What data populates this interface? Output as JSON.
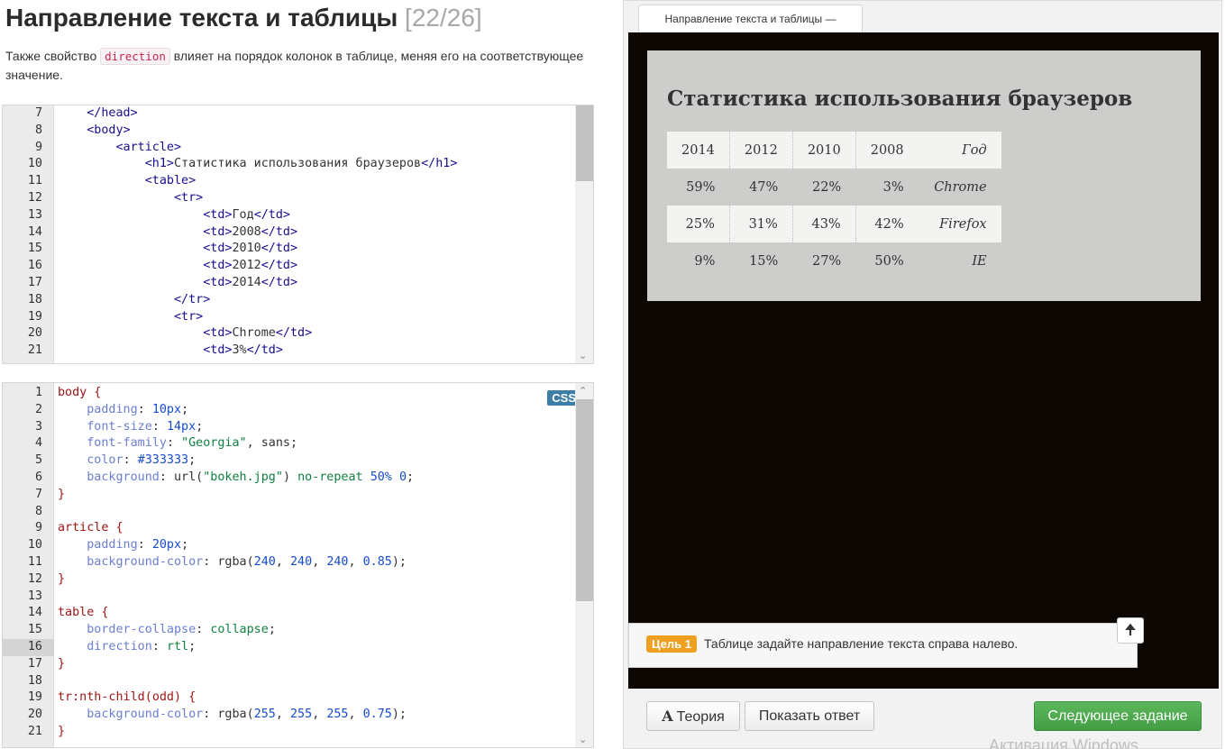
{
  "header": {
    "title": "Направление текста и таблицы",
    "progress": "[22/26]",
    "intro_before": "Также свойство ",
    "intro_code": "direction",
    "intro_after": " влияет на порядок колонок в таблице, меняя его на соответствующее значение."
  },
  "html_editor": {
    "lines": [
      {
        "n": "7"
      },
      {
        "n": "8"
      },
      {
        "n": "9"
      },
      {
        "n": "10"
      },
      {
        "n": "11"
      },
      {
        "n": "12"
      },
      {
        "n": "13"
      },
      {
        "n": "14"
      },
      {
        "n": "15"
      },
      {
        "n": "16"
      },
      {
        "n": "17"
      },
      {
        "n": "18"
      },
      {
        "n": "19"
      },
      {
        "n": "20"
      },
      {
        "n": "21"
      }
    ],
    "code": {
      "l7": "</head>",
      "l8": "<body>",
      "l9": "<article>",
      "l10a": "<h1>",
      "l10b": "Статистика использования браузеров",
      "l10c": "</h1>",
      "l11": "<table>",
      "l12": "<tr>",
      "l13a": "<td>",
      "l13b": "Год",
      "l13c": "</td>",
      "l14a": "<td>",
      "l14b": "2008",
      "l14c": "</td>",
      "l15a": "<td>",
      "l15b": "2010",
      "l15c": "</td>",
      "l16a": "<td>",
      "l16b": "2012",
      "l16c": "</td>",
      "l17a": "<td>",
      "l17b": "2014",
      "l17c": "</td>",
      "l18": "</tr>",
      "l19": "<tr>",
      "l20a": "<td>",
      "l20b": "Chrome",
      "l20c": "</td>",
      "l21a": "<td>",
      "l21b": "3%",
      "l21c": "</td>"
    }
  },
  "css_editor": {
    "badge": "CSS",
    "lines": [
      {
        "n": "1"
      },
      {
        "n": "2"
      },
      {
        "n": "3"
      },
      {
        "n": "4"
      },
      {
        "n": "5"
      },
      {
        "n": "6"
      },
      {
        "n": "7"
      },
      {
        "n": "8"
      },
      {
        "n": "9"
      },
      {
        "n": "10"
      },
      {
        "n": "11"
      },
      {
        "n": "12"
      },
      {
        "n": "13"
      },
      {
        "n": "14"
      },
      {
        "n": "15"
      },
      {
        "n": "16"
      },
      {
        "n": "17"
      },
      {
        "n": "18"
      },
      {
        "n": "19"
      },
      {
        "n": "20"
      },
      {
        "n": "21"
      }
    ],
    "active_line": "16"
  },
  "preview": {
    "tab_label": "Направление текста и таблицы —",
    "heading": "Статистика использования браузеров",
    "table": [
      [
        "Год",
        "2008",
        "2010",
        "2012",
        "2014"
      ],
      [
        "Chrome",
        "3%",
        "22%",
        "47%",
        "59%"
      ],
      [
        "Firefox",
        "42%",
        "43%",
        "31%",
        "25%"
      ],
      [
        "IE",
        "50%",
        "27%",
        "15%",
        "9%"
      ]
    ]
  },
  "goal": {
    "badge": "Цель 1",
    "text": "Таблице задайте направление текста справа налево."
  },
  "buttons": {
    "theory": "Теория",
    "show_answer": "Показать ответ",
    "next": "Следующее задание"
  },
  "watermark": "Активация Windows"
}
